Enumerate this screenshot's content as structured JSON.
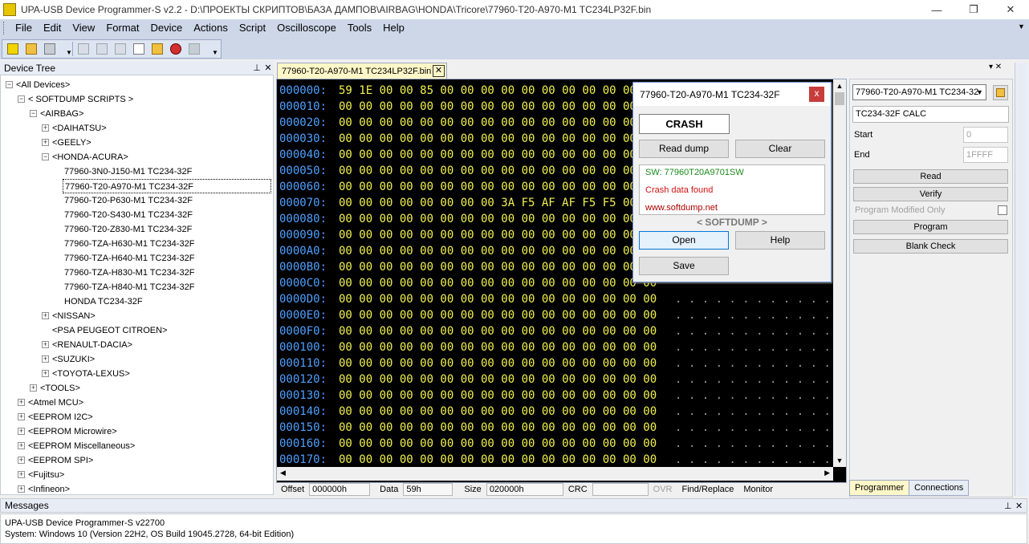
{
  "window": {
    "title": "UPA-USB Device Programmer-S v2.2 - D:\\ПРОЕКТЫ СКРИПТОВ\\БАЗА ДАМПОВ\\AIRBAG\\HONDA\\Tricore\\77960-T20-A970-M1 TC234LP32F.bin",
    "minimize_glyph": "—",
    "restore_glyph": "❐",
    "close_glyph": "✕"
  },
  "menu": [
    "File",
    "Edit",
    "View",
    "Format",
    "Device",
    "Actions",
    "Script",
    "Oscilloscope",
    "Tools",
    "Help"
  ],
  "device_tree": {
    "title": "Device Tree",
    "pin_glyph": "𝟐",
    "close_glyph": "✕",
    "nodes": [
      {
        "label": "<All Devices>",
        "expander": "−"
      },
      {
        "label": "< SOFTDUMP SCRIPTS >",
        "expander": "−"
      },
      {
        "label": "<AIRBAG>",
        "expander": "−"
      },
      {
        "label": "<DAIHATSU>",
        "expander": "+"
      },
      {
        "label": "<GEELY>",
        "expander": "+"
      },
      {
        "label": "<HONDA-ACURA>",
        "expander": "−"
      },
      {
        "label": "77960-3N0-J150-M1 TC234-32F",
        "expander": ""
      },
      {
        "label": "77960-T20-A970-M1 TC234-32F",
        "expander": ""
      },
      {
        "label": "77960-T20-P630-M1 TC234-32F",
        "expander": ""
      },
      {
        "label": "77960-T20-S430-M1 TC234-32F",
        "expander": ""
      },
      {
        "label": "77960-T20-Z830-M1 TC234-32F",
        "expander": ""
      },
      {
        "label": "77960-TZA-H630-M1 TC234-32F",
        "expander": ""
      },
      {
        "label": "77960-TZA-H640-M1 TC234-32F",
        "expander": ""
      },
      {
        "label": "77960-TZA-H830-M1 TC234-32F",
        "expander": ""
      },
      {
        "label": "77960-TZA-H840-M1 TC234-32F",
        "expander": ""
      },
      {
        "label": "HONDA TC234-32F",
        "expander": ""
      },
      {
        "label": "<NISSAN>",
        "expander": "+"
      },
      {
        "label": "<PSA PEUGEOT CITROEN>",
        "expander": ""
      },
      {
        "label": "<RENAULT-DACIA>",
        "expander": "+"
      },
      {
        "label": "<SUZUKI>",
        "expander": "+"
      },
      {
        "label": "<TOYOTA-LEXUS>",
        "expander": "+"
      },
      {
        "label": "<TOOLS>",
        "expander": "+"
      },
      {
        "label": "<Atmel MCU>",
        "expander": "+"
      },
      {
        "label": "<EEPROM I2C>",
        "expander": "+"
      },
      {
        "label": "<EEPROM Microwire>",
        "expander": "+"
      },
      {
        "label": "<EEPROM Miscellaneous>",
        "expander": "+"
      },
      {
        "label": "<EEPROM SPI>",
        "expander": "+"
      },
      {
        "label": "<Fujitsu>",
        "expander": "+"
      },
      {
        "label": "<Infineon>",
        "expander": "+"
      }
    ]
  },
  "editor": {
    "tab_label": "77960-T20-A970-M1 TC234LP32F.bin",
    "tab_close": "✕",
    "rows": [
      {
        "addr": "000000:",
        "bytes": "59 1E 00 00 85 00 00 00 00 00 00 00 00 00 00 00",
        "ascii": ""
      },
      {
        "addr": "000010:",
        "bytes": "00 00 00 00 00 00 00 00 00 00 00 00 00 00 00 00",
        "ascii": ""
      },
      {
        "addr": "000020:",
        "bytes": "00 00 00 00 00 00 00 00 00 00 00 00 00 00 00 00",
        "ascii": ""
      },
      {
        "addr": "000030:",
        "bytes": "00 00 00 00 00 00 00 00 00 00 00 00 00 00 00 00",
        "ascii": ""
      },
      {
        "addr": "000040:",
        "bytes": "00 00 00 00 00 00 00 00 00 00 00 00 00 00 00 00",
        "ascii": ""
      },
      {
        "addr": "000050:",
        "bytes": "00 00 00 00 00 00 00 00 00 00 00 00 00 00 00 00",
        "ascii": ""
      },
      {
        "addr": "000060:",
        "bytes": "00 00 00 00 00 00 00 00 00 00 00 00 00 00 00 00",
        "ascii": ""
      },
      {
        "addr": "000070:",
        "bytes": "00 00 00 00 00 00 00 00 3A F5 AF AF F5 F5 00 00",
        "ascii": ""
      },
      {
        "addr": "000080:",
        "bytes": "00 00 00 00 00 00 00 00 00 00 00 00 00 00 00 00",
        "ascii": ""
      },
      {
        "addr": "000090:",
        "bytes": "00 00 00 00 00 00 00 00 00 00 00 00 00 00 00 00",
        "ascii": ""
      },
      {
        "addr": "0000A0:",
        "bytes": "00 00 00 00 00 00 00 00 00 00 00 00 00 00 00 00",
        "ascii": ""
      },
      {
        "addr": "0000B0:",
        "bytes": "00 00 00 00 00 00 00 00 00 00 00 00 00 00 00 00",
        "ascii": ""
      },
      {
        "addr": "0000C0:",
        "bytes": "00 00 00 00 00 00 00 00 00 00 00 00 00 00 00 00",
        "ascii": ""
      },
      {
        "addr": "0000D0:",
        "bytes": "00 00 00 00 00 00 00 00 00 00 00 00 00 00 00 00",
        "ascii": ". . . . . . . . . . . . . . . ."
      },
      {
        "addr": "0000E0:",
        "bytes": "00 00 00 00 00 00 00 00 00 00 00 00 00 00 00 00",
        "ascii": ". . . . . . . . . . . . . . . ."
      },
      {
        "addr": "0000F0:",
        "bytes": "00 00 00 00 00 00 00 00 00 00 00 00 00 00 00 00",
        "ascii": ". . . . . . . . . . . . . . . ."
      },
      {
        "addr": "000100:",
        "bytes": "00 00 00 00 00 00 00 00 00 00 00 00 00 00 00 00",
        "ascii": ". . . . . . . . . . . . . . . ."
      },
      {
        "addr": "000110:",
        "bytes": "00 00 00 00 00 00 00 00 00 00 00 00 00 00 00 00",
        "ascii": ". . . . . . . . . . . . . . . ."
      },
      {
        "addr": "000120:",
        "bytes": "00 00 00 00 00 00 00 00 00 00 00 00 00 00 00 00",
        "ascii": ". . . . . . . . . . . . . . . ."
      },
      {
        "addr": "000130:",
        "bytes": "00 00 00 00 00 00 00 00 00 00 00 00 00 00 00 00",
        "ascii": ". . . . . . . . . . . . . . . ."
      },
      {
        "addr": "000140:",
        "bytes": "00 00 00 00 00 00 00 00 00 00 00 00 00 00 00 00",
        "ascii": ". . . . . . . . . . . . . . . ."
      },
      {
        "addr": "000150:",
        "bytes": "00 00 00 00 00 00 00 00 00 00 00 00 00 00 00 00",
        "ascii": ". . . . . . . . . . . . . . . ."
      },
      {
        "addr": "000160:",
        "bytes": "00 00 00 00 00 00 00 00 00 00 00 00 00 00 00 00",
        "ascii": ". . . . . . . . . . . . . . . ."
      },
      {
        "addr": "000170:",
        "bytes": "00 00 00 00 00 00 00 00 00 00 00 00 00 00 00 00",
        "ascii": ". . . . . . . . . . . . . . . ."
      }
    ],
    "status": {
      "offset_label": "Offset",
      "offset_value": "000000h",
      "data_label": "Data",
      "data_value": "59h",
      "size_label": "Size",
      "size_value": "020000h",
      "crc_label": "CRC",
      "crc_value": "",
      "ovr_label": "OVR",
      "findreplace_label": "Find/Replace",
      "monitor_label": "Monitor"
    }
  },
  "dialog": {
    "title": "77960-T20-A970-M1 TC234-32F",
    "close_glyph": "x",
    "crash_label": "CRASH",
    "read_dump_label": "Read dump",
    "clear_label": "Clear",
    "sw_text": "SW: 77960T20A9701SW",
    "crash_found_text": "Crash data found",
    "site_text": "www.softdump.net",
    "brand_text": "< SOFTDUMP >",
    "open_label": "Open",
    "help_label": "Help",
    "save_label": "Save",
    "colors": {
      "sw": "#1a8a1a",
      "crash": "#d01010",
      "site": "#b00000",
      "close_bg": "#c83c3c"
    }
  },
  "right_panel": {
    "device_select": "77960-T20-A970-M1 TC234-32",
    "calc_label": "TC234-32F CALC",
    "start_label": "Start",
    "start_value": "0",
    "end_label": "End",
    "end_value": "1FFFF",
    "read_label": "Read",
    "verify_label": "Verify",
    "modified_only_label": "Program Modified Only",
    "program_label": "Program",
    "blank_check_label": "Blank Check",
    "tabs": [
      "Programmer",
      "Connections"
    ]
  },
  "messages": {
    "title": "Messages",
    "lines": [
      "UPA-USB Device Programmer-S v22700",
      "System: Windows 10 (Version 22H2, OS Build 19045.2728, 64-bit Edition)"
    ]
  }
}
